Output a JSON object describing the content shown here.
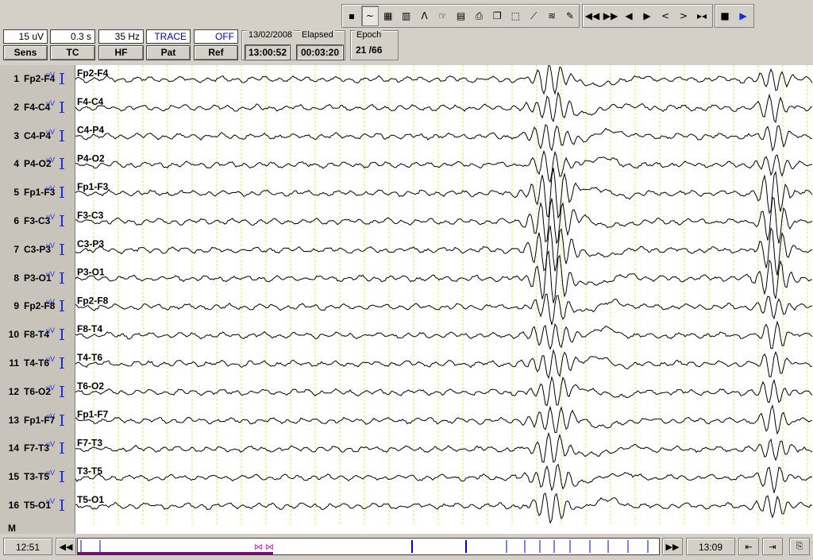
{
  "toolbar": {
    "tools": [
      {
        "name": "save-icon",
        "glyph": "▪"
      },
      {
        "name": "waveform-mode-icon",
        "glyph": "~",
        "pressed": true
      },
      {
        "name": "montage-grid-icon",
        "glyph": "▦"
      },
      {
        "name": "spectrum-icon",
        "glyph": "▥"
      },
      {
        "name": "peak-marker-icon",
        "glyph": "Λ"
      },
      {
        "name": "cursor-hand-icon",
        "glyph": "☞"
      },
      {
        "name": "notes-icon",
        "glyph": "▤"
      },
      {
        "name": "print-icon",
        "glyph": "⎙"
      },
      {
        "name": "copy-icon",
        "glyph": "❐"
      },
      {
        "name": "select-region-icon",
        "glyph": "⬚"
      },
      {
        "name": "ruler-icon",
        "glyph": "⟋"
      },
      {
        "name": "filter-wave-icon",
        "glyph": "≋"
      },
      {
        "name": "report-icon",
        "glyph": "✎"
      }
    ],
    "navigation": [
      {
        "name": "fast-rewind-icon",
        "glyph": "◀◀"
      },
      {
        "name": "fast-forward-icon",
        "glyph": "▶▶"
      },
      {
        "name": "step-back-icon",
        "glyph": "◀"
      },
      {
        "name": "step-forward-icon",
        "glyph": "▶"
      },
      {
        "name": "page-back-icon",
        "glyph": "<"
      },
      {
        "name": "page-forward-icon",
        "glyph": ">"
      },
      {
        "name": "goto-marker-icon",
        "glyph": "▸◂"
      }
    ],
    "playback": [
      {
        "name": "stop-icon",
        "glyph": "■"
      },
      {
        "name": "play-icon",
        "glyph": "▶"
      }
    ]
  },
  "params": {
    "sens": {
      "value": "15 uV",
      "label": "Sens"
    },
    "tc": {
      "value": "0.3 s",
      "label": "TC"
    },
    "hf": {
      "value": "35 Hz",
      "label": "HF"
    },
    "pat": {
      "value": "TRACE",
      "label": "Pat"
    },
    "ref": {
      "value": "OFF",
      "label": "Ref"
    }
  },
  "recording": {
    "date": "13/02/2008",
    "start_time": "13:00:52",
    "elapsed_label": "Elapsed",
    "elapsed": "00:03:20",
    "epoch_label": "Epoch",
    "epoch": "21 /66"
  },
  "channels": [
    {
      "num": "1",
      "name": "Fp2-F4",
      "unit": "uV"
    },
    {
      "num": "2",
      "name": "F4-C4",
      "unit": "uV"
    },
    {
      "num": "3",
      "name": "C4-P4",
      "unit": "uV"
    },
    {
      "num": "4",
      "name": "P4-O2",
      "unit": "uV"
    },
    {
      "num": "5",
      "name": "Fp1-F3",
      "unit": "uV"
    },
    {
      "num": "6",
      "name": "F3-C3",
      "unit": "uV"
    },
    {
      "num": "7",
      "name": "C3-P3",
      "unit": "uV"
    },
    {
      "num": "8",
      "name": "P3-O1",
      "unit": "uV"
    },
    {
      "num": "9",
      "name": "Fp2-F8",
      "unit": "uV"
    },
    {
      "num": "10",
      "name": "F8-T4",
      "unit": "uV"
    },
    {
      "num": "11",
      "name": "T4-T6",
      "unit": "uV"
    },
    {
      "num": "12",
      "name": "T6-O2",
      "unit": "uV"
    },
    {
      "num": "13",
      "name": "Fp1-F7",
      "unit": "uV"
    },
    {
      "num": "14",
      "name": "F7-T3",
      "unit": "uV"
    },
    {
      "num": "15",
      "name": "T3-T5",
      "unit": "uV"
    },
    {
      "num": "16",
      "name": "T5-O1",
      "unit": "uV"
    }
  ],
  "trace_labels": [
    "Fp2-F4",
    "F4-C4",
    "C4-P4",
    "P4-O2",
    "Fp1-F3",
    "F3-C3",
    "C3-P3",
    "P3-O1",
    "Fp2-F8",
    "F8-T4",
    "T4-T6",
    "T6-O2",
    "Fp1-F7",
    "F7-T3",
    "T3-T5",
    "T5-O1"
  ],
  "marker_row_label": "M",
  "timeline": {
    "start": "12:51",
    "end": "13:09"
  },
  "colors": {
    "grid_line": "#f0e060",
    "trace": "#000000",
    "channel_label_blue": "#2030d0",
    "timeline_marker": "#0000c0",
    "progress_bar": "#800080"
  }
}
